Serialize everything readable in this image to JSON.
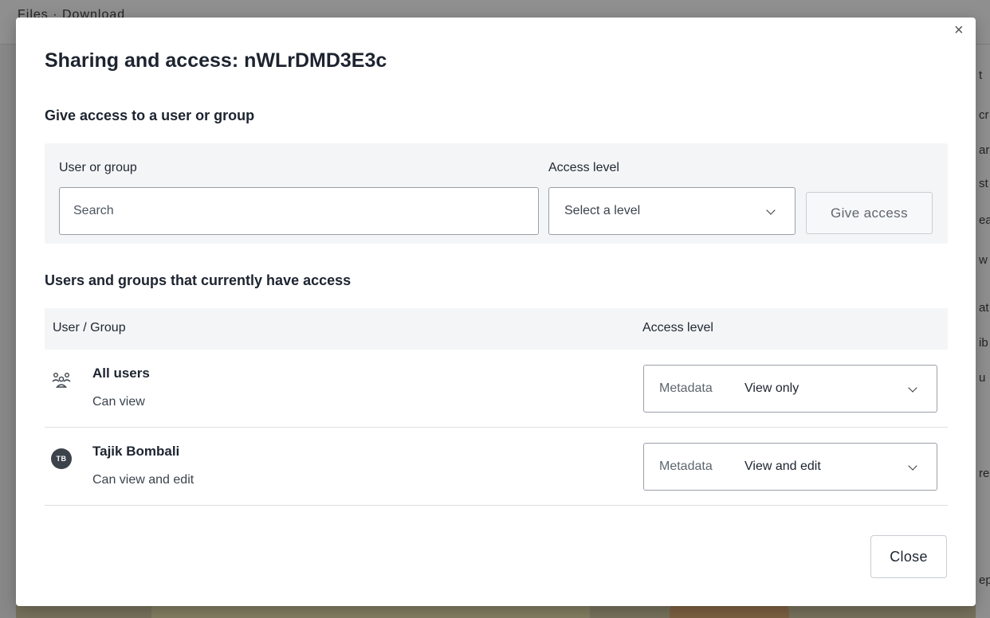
{
  "background": {
    "breadcrumb": "Files · Download",
    "right_fragments": [
      "t",
      "cr",
      "ar",
      "st",
      "ea",
      "w",
      "at",
      "ib",
      "u",
      "re",
      "ep"
    ]
  },
  "modal": {
    "title": "Sharing and access: nWLrDMD3E3c",
    "close_icon": "×",
    "give_section": {
      "title": "Give access to a user or group",
      "user_label": "User or group",
      "search_placeholder": "Search",
      "level_label": "Access level",
      "level_select_value": "Select a level",
      "give_button": "Give access"
    },
    "current_section": {
      "title": "Users and groups that currently have access",
      "columns": [
        "User / Group",
        "Access level"
      ],
      "rows": [
        {
          "icon": "users-group-icon",
          "name": "All users",
          "permission": "Can view",
          "access_key": "Metadata",
          "access_value": "View only"
        },
        {
          "icon": "avatar",
          "avatar_initials": "TB",
          "name": "Tajik Bombali",
          "permission": "Can view and edit",
          "access_key": "Metadata",
          "access_value": "View and edit"
        }
      ]
    },
    "close_button": "Close"
  }
}
